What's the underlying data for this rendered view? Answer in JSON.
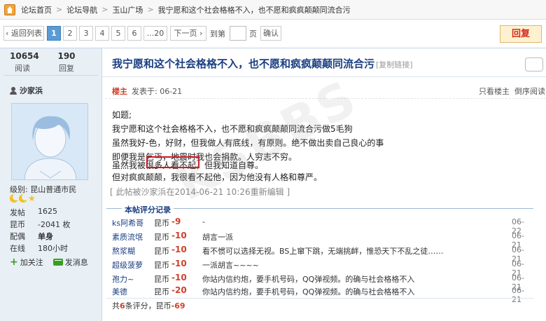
{
  "breadcrumb": {
    "items": [
      "论坛首页",
      "论坛导航",
      "玉山广场",
      "我宁愿和这个社会格格不入，也不愿和疯疯颠颠同流合污"
    ],
    "sep": ">"
  },
  "pager": {
    "back": "‹ 返回列表",
    "pages": [
      "1",
      "2",
      "3",
      "4",
      "5",
      "6",
      "...20"
    ],
    "next": "下一页 ›",
    "goto_label": "到第",
    "page_unit": "页",
    "confirm": "确认",
    "reply": "回复"
  },
  "stats": {
    "views": "10654",
    "views_label": "阅读",
    "replies": "190",
    "replies_label": "回复"
  },
  "author": {
    "name": "沙家浜",
    "level": "级别: 昆山普通市民",
    "info": [
      {
        "k": "发帖",
        "v": "1625"
      },
      {
        "k": "昆币",
        "v": "-2041 枚"
      },
      {
        "k": "配偶",
        "v": "单身"
      },
      {
        "k": "在线",
        "v": "180小时"
      }
    ],
    "follow": "加关注",
    "message": "发消息"
  },
  "post": {
    "title": "我宁愿和这个社会格格不入，也不愿和疯疯颠颠同流合污",
    "copy_link": "[复制链接]",
    "owner": "楼主",
    "date": "发表于: 06-21",
    "only_owner": "只看楼主",
    "reverse": "倒序阅读",
    "lines": [
      "如题;",
      "我宁愿和这个社会格格不入，也不愿和疯疯颠颠同流合污做5毛狗",
      "虽然我好-色，好财，但我做人有底线，有原则。绝不做出卖自己良心的事",
      "即便我是乞丐，地震时我也会捐款。人穷志不穷。",
      "虽然我被很多人看不起，但我知道自尊。",
      "但对疯疯颠颠，我很看不起他，因为他没有人格和尊严。"
    ],
    "edit_note": "[ 此帖被沙家浜在2014-06-21 10:26重新编辑 ]"
  },
  "ratings": {
    "title": "本帖评分记录",
    "rows": [
      {
        "user": "ks阿希哥",
        "currency": "昆币",
        "score": "-9",
        "reason": "-",
        "date": "06-22"
      },
      {
        "user": "素质流氓",
        "currency": "昆币",
        "score": "-10",
        "reason": "胡言一派",
        "date": "06-21"
      },
      {
        "user": "熬浆糊",
        "currency": "昆币",
        "score": "-10",
        "reason": "看不惯可以选择无视。BS上窜下跳，无端挑衅，惟恐天下不乱之徒……",
        "date": "06-21"
      },
      {
        "user": "超级菠萝",
        "currency": "昆币",
        "score": "-10",
        "reason": "一派胡言~~~~",
        "date": "06-21"
      },
      {
        "user": "孢力~",
        "currency": "昆币",
        "score": "-10",
        "reason": "你站内信约炮，要手机号码，QQ弹视频。的确与社会格格不入",
        "date": "06-21"
      },
      {
        "user": "美德",
        "currency": "昆币",
        "score": "-20",
        "reason": "你站内信约炮，要手机号码，QQ弹视频。的确与社会格格不入",
        "date": "06-21"
      }
    ],
    "foot_pre": "共",
    "foot_count": "6",
    "foot_mid": "条评分，昆币",
    "foot_total": "-69"
  },
  "watermark": "KSBBS"
}
